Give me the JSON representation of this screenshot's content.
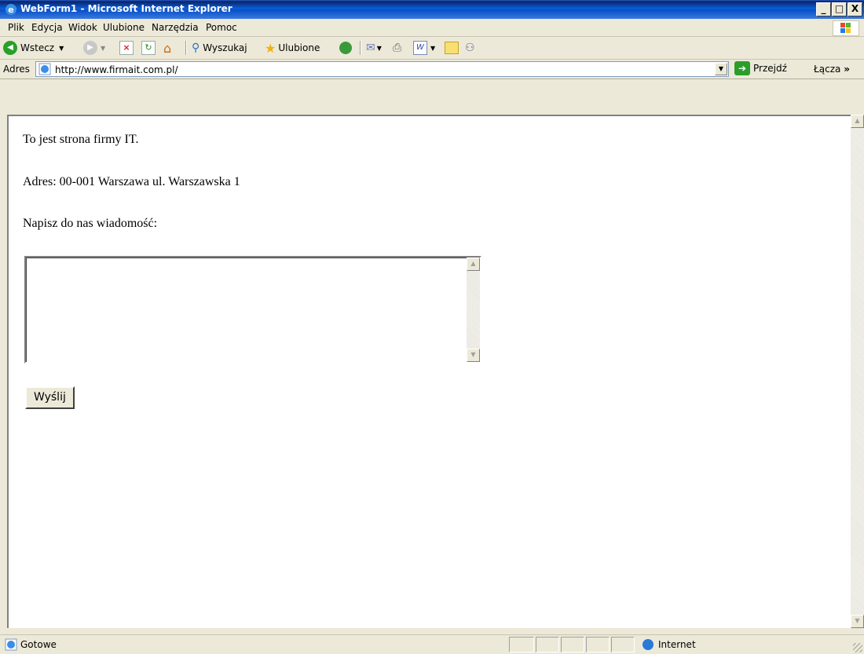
{
  "window": {
    "title": "WebForm1 - Microsoft Internet Explorer",
    "minimize": "_",
    "maximize": "□",
    "close": "X"
  },
  "menu": {
    "items": [
      "Plik",
      "Edycja",
      "Widok",
      "Ulubione",
      "Narzędzia",
      "Pomoc"
    ]
  },
  "toolbar": {
    "back_label": "Wstecz",
    "search_label": "Wyszukaj",
    "favorites_label": "Ulubione",
    "icons": [
      "back-icon",
      "forward-icon",
      "stop-icon",
      "refresh-icon",
      "home-icon",
      "search-icon",
      "favorites-icon",
      "history-icon",
      "mail-icon",
      "print-icon",
      "edit-icon",
      "notes-icon",
      "messenger-icon"
    ]
  },
  "address": {
    "label": "Adres",
    "url": "http://www.firmait.com.pl/",
    "go_label": "Przejdź",
    "links_label": "Łącza",
    "more": "»"
  },
  "page": {
    "line1": "To jest strona firmy IT.",
    "line2": "Adres: 00-001 Warszawa ul. Warszawska 1",
    "line3": "Napisz do nas wiadomość:",
    "message_value": "",
    "submit_label": "Wyślij"
  },
  "status": {
    "text": "Gotowe",
    "zone": "Internet"
  },
  "colors": {
    "titlebar": "#0a5ed8",
    "chrome": "#ece9d8",
    "content_bg": "#ffffff"
  }
}
